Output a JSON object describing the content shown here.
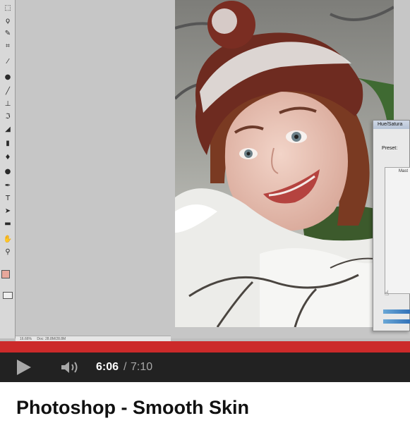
{
  "video": {
    "title": "Photoshop - Smooth Skin",
    "time_current": "6:06",
    "time_separator": "/",
    "time_total": "7:10",
    "progress": 1.0,
    "colors": {
      "progress": "#cc2a2a",
      "controls_bg": "#222222",
      "accent_text": "#ffffff"
    }
  },
  "photoshop": {
    "dialog_title": "Hue/Satura",
    "preset_label": "Preset:",
    "master_label": "Mast",
    "status_zoom": "16.66%",
    "status_doc": "Doc: 28.8M/28.8M",
    "foreground_color": "#e7a79b",
    "tools": [
      "marquee-icon",
      "lasso-icon",
      "quick-select-icon",
      "crop-icon",
      "eyedropper-icon",
      "healing-icon",
      "brush-icon",
      "clone-stamp-icon",
      "history-brush-icon",
      "eraser-icon",
      "gradient-icon",
      "blur-icon",
      "dodge-icon",
      "pen-icon",
      "type-icon",
      "path-select-icon",
      "shape-icon",
      "hand-icon",
      "zoom-icon"
    ]
  }
}
